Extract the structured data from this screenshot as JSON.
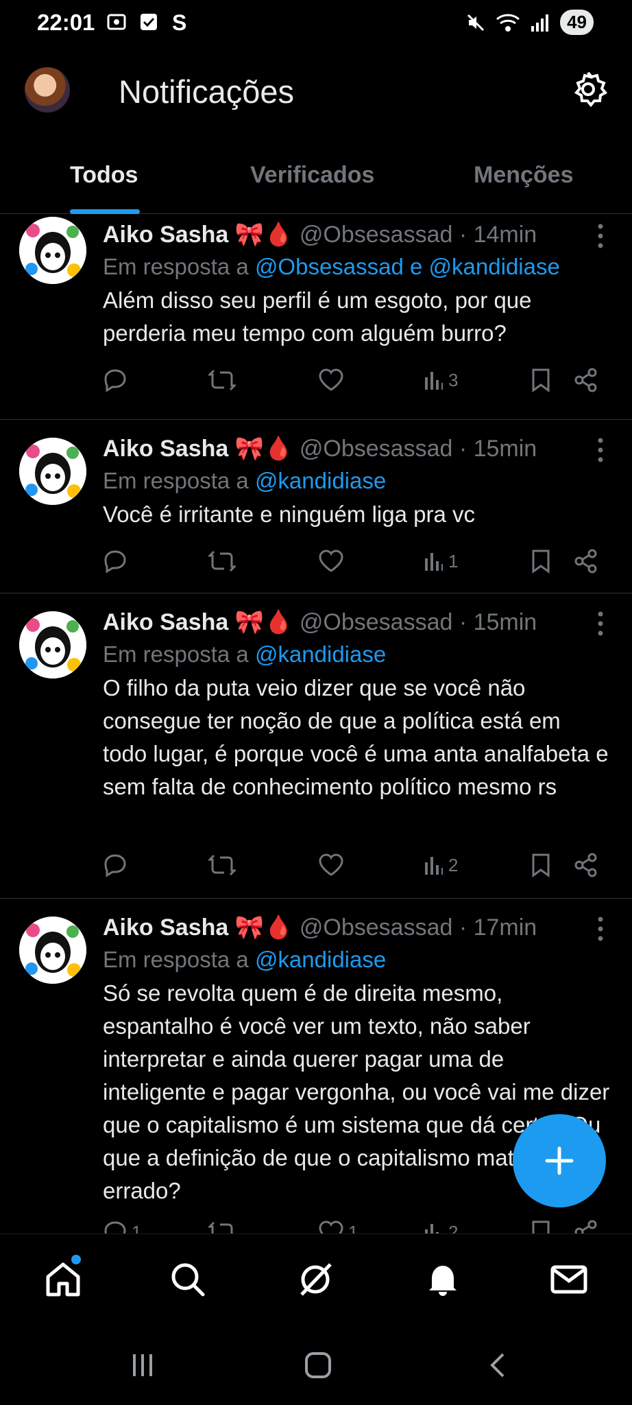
{
  "status_bar": {
    "time": "22:01",
    "battery": "49"
  },
  "header": {
    "title": "Notificações"
  },
  "tabs": [
    {
      "label": "Todos",
      "active": true
    },
    {
      "label": "Verificados",
      "active": false
    },
    {
      "label": "Menções",
      "active": false
    }
  ],
  "tweets": [
    {
      "name": "Aiko Sasha 🎀🩸",
      "handle": "@Obsesassad · 14min",
      "reply_prefix": "Em resposta a ",
      "reply_mentions": "@Obsesassad e @kandidiase",
      "text": "Além disso seu perfil é um esgoto, por que perderia meu tempo com alguém burro?",
      "replies": "",
      "retweets": "",
      "likes": "",
      "views": "3"
    },
    {
      "name": "Aiko Sasha 🎀🩸",
      "handle": "@Obsesassad · 15min",
      "reply_prefix": "Em resposta a ",
      "reply_mentions": "@kandidiase",
      "text": "Você é irritante e ninguém liga pra vc",
      "replies": "",
      "retweets": "",
      "likes": "",
      "views": "1"
    },
    {
      "name": "Aiko Sasha 🎀🩸",
      "handle": "@Obsesassad · 15min",
      "reply_prefix": "Em resposta a ",
      "reply_mentions": "@kandidiase",
      "text": "O filho da puta veio dizer que se você não consegue ter noção de que a política está em todo lugar, é porque você é uma anta analfabeta e sem falta de conhecimento político mesmo rs",
      "replies": "",
      "retweets": "",
      "likes": "",
      "views": "2"
    },
    {
      "name": "Aiko Sasha 🎀🩸",
      "handle": "@Obsesassad · 17min",
      "reply_prefix": "Em resposta a ",
      "reply_mentions": "@kandidiase",
      "text": "Só se revolta quem é de direita mesmo, espantalho é você ver um texto, não saber interpretar e ainda querer pagar uma de inteligente e pagar vergonha, ou você vai me dizer que o capitalismo é um sistema que dá certo? Ou que a definição de que o capitalismo mata tá errado?",
      "replies": "1",
      "retweets": "",
      "likes": "1",
      "views": "2"
    }
  ],
  "colors": {
    "accent": "#1d9bf0",
    "muted": "#71767b",
    "text": "#e7e9ea",
    "divider": "#2f3336"
  }
}
